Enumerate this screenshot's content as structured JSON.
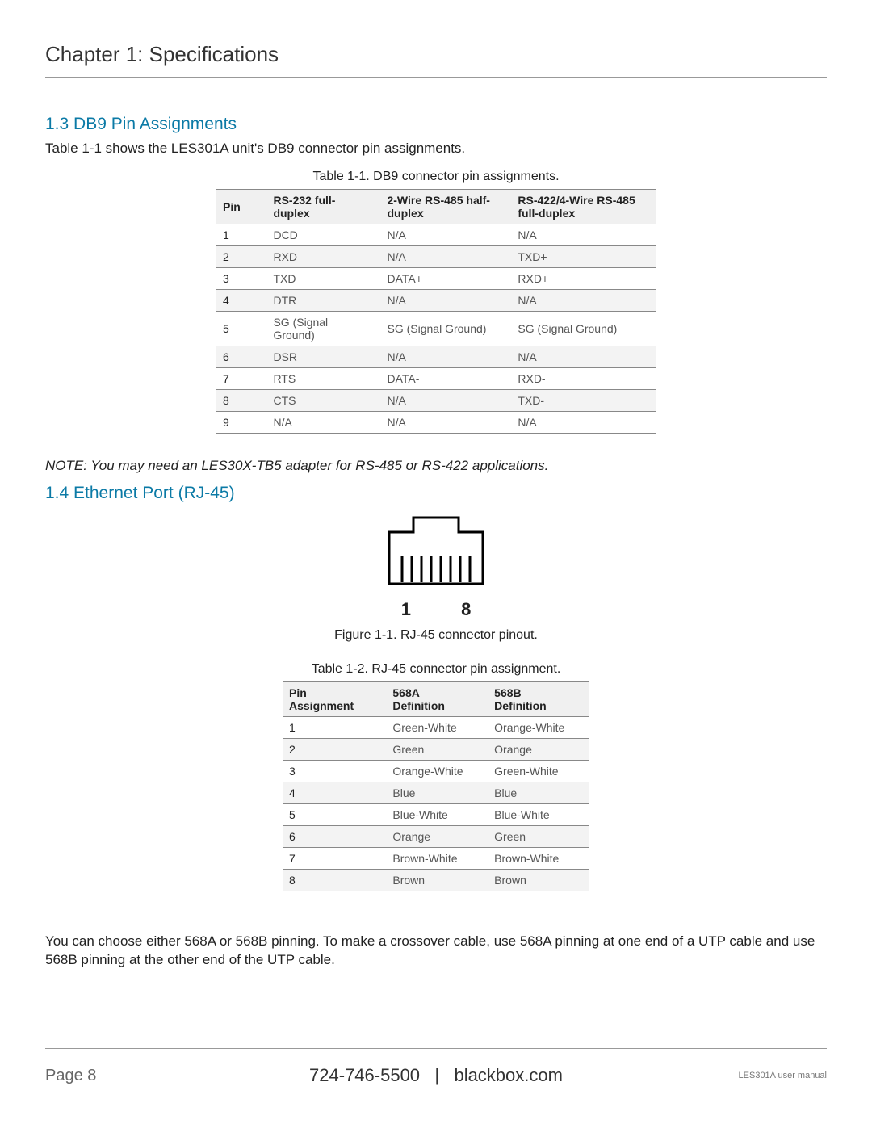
{
  "chapter": {
    "title": "Chapter 1: Specifications"
  },
  "section_1_3": {
    "heading": "1.3 DB9 Pin Assignments",
    "intro": "Table 1-1 shows the LES301A unit's DB9 connector pin assignments.",
    "caption": "Table 1-1. DB9 connector pin assignments.",
    "table": {
      "headers": [
        "Pin",
        "RS-232 full-duplex",
        "2-Wire RS-485 half-duplex",
        "RS-422/4-Wire RS-485 full-duplex"
      ],
      "rows": [
        [
          "1",
          "DCD",
          "N/A",
          "N/A"
        ],
        [
          "2",
          "RXD",
          "N/A",
          "TXD+"
        ],
        [
          "3",
          "TXD",
          "DATA+",
          "RXD+"
        ],
        [
          "4",
          "DTR",
          "N/A",
          "N/A"
        ],
        [
          "5",
          "SG (Signal Ground)",
          "SG (Signal Ground)",
          "SG (Signal Ground)"
        ],
        [
          "6",
          "DSR",
          "N/A",
          "N/A"
        ],
        [
          "7",
          "RTS",
          "DATA-",
          "RXD-"
        ],
        [
          "8",
          "CTS",
          "N/A",
          "TXD-"
        ],
        [
          "9",
          "N/A",
          "N/A",
          "N/A"
        ]
      ]
    },
    "note": "NOTE: You may need an LES30X-TB5 adapter for RS-485 or RS-422 applications."
  },
  "section_1_4": {
    "heading": "1.4 Ethernet Port (RJ-45)",
    "figure": {
      "pin_left": "1",
      "pin_right": "8",
      "caption": "Figure 1-1. RJ-45 connector pinout."
    },
    "table_caption": "Table 1-2. RJ-45 connector pin assignment.",
    "table": {
      "headers": [
        "Pin Assignment",
        "568A Definition",
        "568B Definition"
      ],
      "rows": [
        [
          "1",
          "Green-White",
          "Orange-White"
        ],
        [
          "2",
          "Green",
          "Orange"
        ],
        [
          "3",
          "Orange-White",
          "Green-White"
        ],
        [
          "4",
          "Blue",
          "Blue"
        ],
        [
          "5",
          "Blue-White",
          "Blue-White"
        ],
        [
          "6",
          "Orange",
          "Green"
        ],
        [
          "7",
          "Brown-White",
          "Brown-White"
        ],
        [
          "8",
          "Brown",
          "Brown"
        ]
      ]
    },
    "footnote": "You can choose either 568A or 568B pinning. To make a crossover cable, use 568A pinning at one end of a UTP cable and use 568B pinning at the other end of the UTP cable."
  },
  "footer": {
    "page_label": "Page 8",
    "phone": "724-746-5500",
    "sep": "|",
    "site": "blackbox.com",
    "doc": "LES301A user manual"
  }
}
